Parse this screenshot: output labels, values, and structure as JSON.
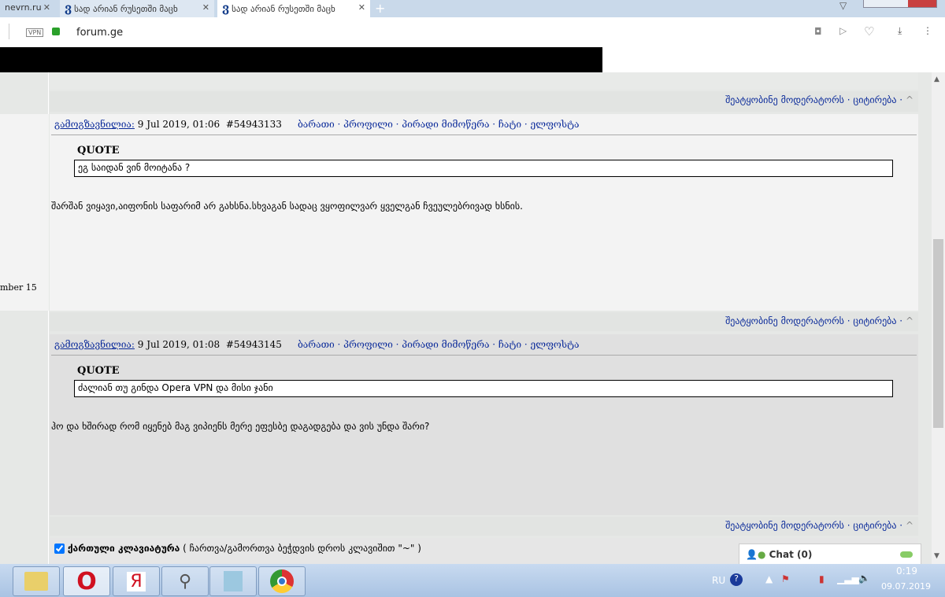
{
  "browser": {
    "tabs": [
      {
        "label": "nevrn.ru"
      },
      {
        "label": "სად არიან რუსეთში მაცხ"
      },
      {
        "label": "სად არიან რუსეთში მაცხ"
      }
    ],
    "vpn": "VPN",
    "url": "forum.ge"
  },
  "sidebar": {
    "joined": "mber 15"
  },
  "footer_links": {
    "report": "შეატყობინე მოდერატორს",
    "quote": "· ციტირება ·",
    "up": "^"
  },
  "posts": [
    {
      "author": "გამოგზავნილია:",
      "date": " 9 Jul 2019, 01:06",
      "id": "#54943133",
      "links": "ბარათი · პროფილი · პირადი მიმოწერა · ჩატი · ელფოსტა",
      "quote_label": "QUOTE",
      "quote": "ეგ საიდან ვინ მოიტანა ?",
      "message": "შარშან ვიყავი,აიფონის საფარიმ არ გახსნა.სხვაგან სადაც ვყოფილვარ ყველგან ჩვეულებრივად ხსნის."
    },
    {
      "author": "გამოგზავნილია:",
      "date": " 9 Jul 2019, 01:08",
      "id": "#54943145",
      "links": "ბარათი · პროფილი · პირადი მიმოწერა · ჩატი · ელფოსტა",
      "quote_label": "QUOTE",
      "quote": "ძალიან თუ გინდა Opera VPN და მისი ჯანი",
      "message": "ჰო და ხშირად რომ იყენებ მაგ ვიპიენს მერე ეფესბე დაგადგება და ვის უნდა შარი?"
    }
  ],
  "keyboard": {
    "label": "ქართული კლავიატურა",
    "hint": " ( ჩართვა/გამორთვა ბეჭდვის დროს კლავიშით \"~\" )"
  },
  "chat": {
    "label": "Chat",
    "count": "(0)"
  },
  "tray": {
    "lang": "RU",
    "time": "0:19",
    "date": "09.07.2019"
  }
}
